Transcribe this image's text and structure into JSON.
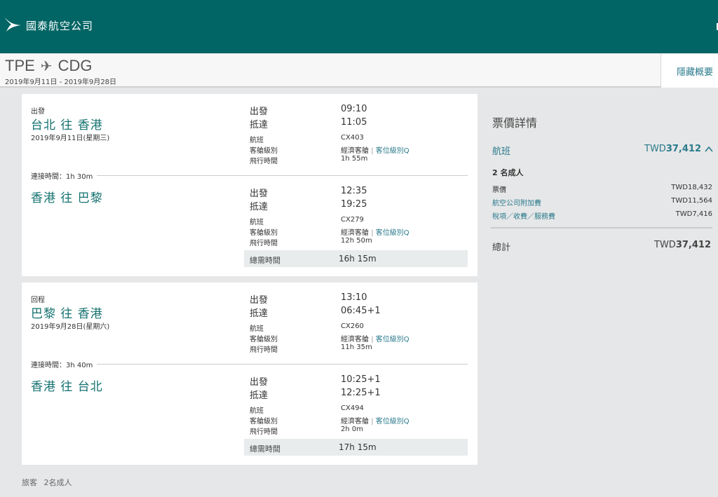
{
  "header": {
    "brand": "國泰航空公司"
  },
  "route": {
    "origin": "TPE",
    "destination": "CDG",
    "dates": "2019年9月11日 - 2019年9月28日",
    "toggle": "隱藏概要"
  },
  "labels": {
    "depart": "出發",
    "arrive": "抵達",
    "flight": "航班",
    "cabin": "客艙級別",
    "duration": "飛行時間",
    "total_time": "總需時間",
    "cabin_class": "經濟客艙",
    "cabin_sep": "|"
  },
  "outbound": {
    "label": "出發",
    "date": "2019年9月11日(星期三)",
    "connection": "連接時間：1h 30m",
    "total": "16h 15m",
    "segments": [
      {
        "title": "台北 往 香港",
        "depart": "09:10",
        "arrive": "11:05",
        "flight": "CX403",
        "fare_class": "客位級別Q",
        "duration": "1h 55m"
      },
      {
        "title": "香港 往 巴黎",
        "depart": "12:35",
        "arrive": "19:25",
        "flight": "CX279",
        "fare_class": "客位級別Q",
        "duration": "12h 50m"
      }
    ]
  },
  "inbound": {
    "label": "回程",
    "date": "2019年9月28日(星期六)",
    "connection": "連接時間：3h 40m",
    "total": "17h 15m",
    "segments": [
      {
        "title": "巴黎 往 香港",
        "depart": "13:10",
        "arrive": "06:45+1",
        "flight": "CX260",
        "fare_class": "客位級別Q",
        "duration": "11h 35m"
      },
      {
        "title": "香港 往 台北",
        "depart": "10:25+1",
        "arrive": "12:25+1",
        "flight": "CX494",
        "fare_class": "客位級別Q",
        "duration": "2h 0m"
      }
    ]
  },
  "summary": {
    "title": "票價詳情",
    "flights_label": "航班",
    "flights_currency": "TWD",
    "flights_amount": "37,412",
    "adults": "2 名成人",
    "items": [
      {
        "label": "票價",
        "currency": "TWD",
        "amount": "18,432"
      },
      {
        "label": "航空公司附加費",
        "currency": "TWD",
        "amount": "11,564"
      },
      {
        "label": "稅項／收費／服務費",
        "currency": "TWD",
        "amount": "7,416"
      }
    ],
    "total_label": "總計",
    "total_currency": "TWD",
    "total_amount": "37,412"
  },
  "footer": {
    "travellers_label": "旅客",
    "travellers_value": "2名成人"
  }
}
